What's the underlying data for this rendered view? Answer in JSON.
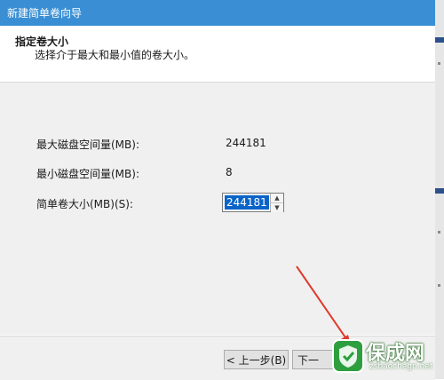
{
  "window": {
    "title": "新建简单卷向导"
  },
  "header": {
    "title": "指定卷大小",
    "subtitle": "选择介于最大和最小值的卷大小。"
  },
  "fields": {
    "max_label": "最大磁盘空间量(MB):",
    "max_value": "244181",
    "min_label": "最小磁盘空间量(MB):",
    "min_value": "8",
    "size_label": "简单卷大小(MB)(S):",
    "size_value": "244181"
  },
  "footer": {
    "back_label": "< 上一步(B)",
    "next_label": "下一"
  },
  "watermark": {
    "title": "保成网",
    "url": "zsbaochegn.net"
  },
  "colors": {
    "titlebar": "#3a8fd4",
    "selection": "#0a64c8",
    "arrow": "#e03a2c"
  }
}
